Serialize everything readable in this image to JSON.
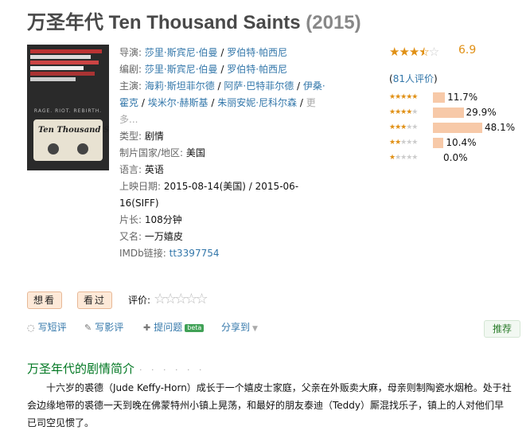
{
  "title": {
    "cn": "万圣年代",
    "en": "Ten Thousand Saints",
    "year": "(2015)"
  },
  "poster": {
    "tagline": "RAGE. RIOT. REBIRTH.",
    "title_text": "Ten Thousand Saints"
  },
  "info": {
    "director_label": "导演:",
    "directors": [
      "莎里·斯宾尼·伯曼",
      "罗伯特·帕西尼"
    ],
    "writer_label": "编剧:",
    "writers": [
      "莎里·斯宾尼·伯曼",
      "罗伯特·帕西尼"
    ],
    "cast_label": "主演:",
    "cast": [
      "海莉·斯坦菲尔德",
      "阿萨·巴特菲尔德",
      "伊桑·霍克",
      "埃米尔·赫斯基",
      "朱丽安妮·尼科尔森"
    ],
    "more": "更多...",
    "genre_label": "类型:",
    "genre": "剧情",
    "country_label": "制片国家/地区:",
    "country": "美国",
    "language_label": "语言:",
    "language": "英语",
    "release_label": "上映日期:",
    "release": "2015-08-14(美国) / 2015-06-16(SIFF)",
    "runtime_label": "片长:",
    "runtime": "108分钟",
    "aka_label": "又名:",
    "aka": "一万嬉皮",
    "imdb_label": "IMDb链接:",
    "imdb": "tt3397754"
  },
  "rating": {
    "score": "6.9",
    "star_level": 3.5,
    "votes_prefix": "(",
    "votes_link": "81人评价",
    "votes_suffix": ")",
    "distribution": [
      {
        "stars": 5,
        "percent": 11.7,
        "label": "11.7%"
      },
      {
        "stars": 4,
        "percent": 29.9,
        "label": "29.9%"
      },
      {
        "stars": 3,
        "percent": 48.1,
        "label": "48.1%"
      },
      {
        "stars": 2,
        "percent": 10.4,
        "label": "10.4%"
      },
      {
        "stars": 1,
        "percent": 0.0,
        "label": "0.0%"
      }
    ],
    "star_color": "#e09015",
    "bar_color": "#f7c9a8"
  },
  "actions": {
    "want_label": "想看",
    "seen_label": "看过",
    "rate_label": "评价:",
    "short_review": "写短评",
    "review": "写影评",
    "ask": "提问题",
    "beta": "beta",
    "share": "分享到",
    "recommend": "推荐"
  },
  "summary": {
    "heading": "万圣年代的剧情简介",
    "dots": "· · · · · ·",
    "text": "十六岁的裘德（Jude Keffy-Horn）成长于一个嬉皮士家庭，父亲在外贩卖大麻，母亲则制陶瓷水烟枪。处于社会边缘地带的裘德一天到晚在佛蒙特州小镇上晃荡，和最好的朋友泰迪（Teddy）厮混找乐子，镇上的人对他们早已司空见惯了。"
  },
  "colors": {
    "link": "#3377aa",
    "green": "#007722"
  }
}
